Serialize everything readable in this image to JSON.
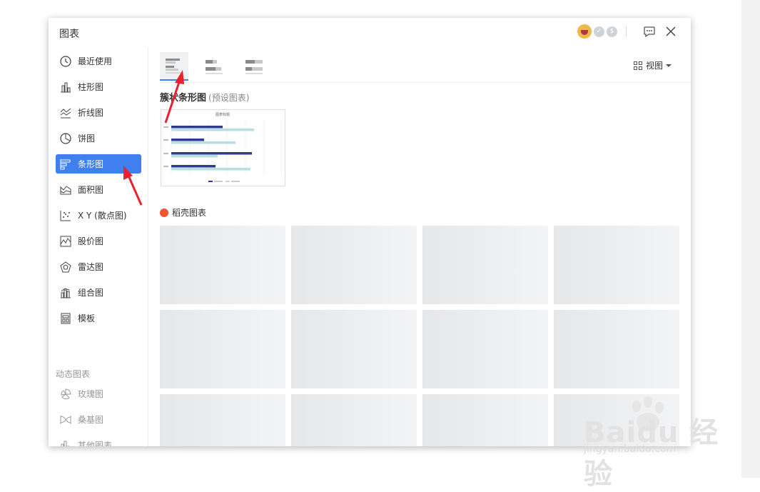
{
  "dialog": {
    "title": "图表"
  },
  "sidebar": {
    "items": [
      {
        "label": "最近使用",
        "icon": "clock-icon"
      },
      {
        "label": "柱形图",
        "icon": "column-chart-icon"
      },
      {
        "label": "折线图",
        "icon": "line-chart-icon"
      },
      {
        "label": "饼图",
        "icon": "pie-chart-icon"
      },
      {
        "label": "条形图",
        "icon": "bar-chart-icon",
        "active": true
      },
      {
        "label": "面积图",
        "icon": "area-chart-icon"
      },
      {
        "label": "X Y (散点图)",
        "icon": "scatter-chart-icon"
      },
      {
        "label": "股价图",
        "icon": "stock-chart-icon"
      },
      {
        "label": "雷达图",
        "icon": "radar-chart-icon"
      },
      {
        "label": "组合图",
        "icon": "combo-chart-icon"
      },
      {
        "label": "模板",
        "icon": "template-icon"
      }
    ],
    "dynamic_section_label": "动态图表",
    "dynamic_items": [
      {
        "label": "玫瑰图",
        "icon": "rose-chart-icon"
      },
      {
        "label": "桑基图",
        "icon": "sankey-chart-icon"
      },
      {
        "label": "其他图表",
        "icon": "other-chart-icon"
      }
    ]
  },
  "toolbar": {
    "view_label": "视图"
  },
  "preset": {
    "title": "簇状条形图",
    "subtitle": "(预设图表)",
    "thumb_title": "图表标题"
  },
  "docer": {
    "title": "稻壳图表"
  },
  "watermark": {
    "brand": "Baidu 经验",
    "url": "jingyan.baidu.com"
  },
  "colors": {
    "accent": "#3f7ff0",
    "series_dark": "#2e3a8c",
    "series_light": "#b7dfe3",
    "arrow": "#e8232d"
  }
}
